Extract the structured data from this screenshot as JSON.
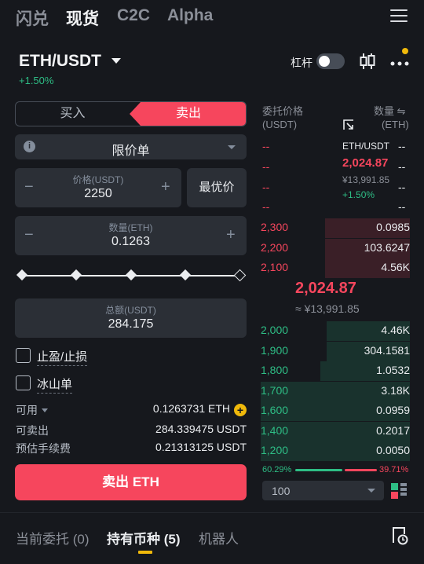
{
  "nav": {
    "tabs": [
      "闪兑",
      "现货",
      "C2C",
      "Alpha"
    ],
    "active": 1
  },
  "header": {
    "pair": "ETH/USDT",
    "change": "+1.50%",
    "leverage_label": "杠杆",
    "leverage_on": false
  },
  "order_form": {
    "buy_label": "买入",
    "sell_label": "卖出",
    "order_type": "限价单",
    "price_label": "价格(USDT)",
    "price_value": "2250",
    "best_price_label": "最优价",
    "amount_label": "数量(ETH)",
    "amount_value": "0.1263",
    "total_label": "总额(USDT)",
    "total_value": "284.175",
    "tp_sl_label": "止盈/止损",
    "iceberg_label": "冰山单",
    "available_label": "可用",
    "available_value": "0.1263731 ETH",
    "sellable_label": "可卖出",
    "sellable_value": "284.339475 USDT",
    "fee_label": "预估手续费",
    "fee_value": "0.21313125 USDT",
    "submit_label": "卖出 ETH",
    "minus": "−",
    "plus": "+"
  },
  "order_book": {
    "price_header": "委托价格",
    "price_unit": "(USDT)",
    "qty_header": "数量",
    "qty_unit": "(ETH)",
    "swap_icon": "⇋",
    "dash": "--",
    "ticker": {
      "pair": "ETH/USDT",
      "price": "2,024.87",
      "cny": "¥13,991.85",
      "change": "+1.50%"
    },
    "asks": [
      {
        "price": "2,300",
        "qty": "0.0985",
        "fill": 0.57
      },
      {
        "price": "2,200",
        "qty": "103.6247",
        "fill": 0.57
      },
      {
        "price": "2,100",
        "qty": "4.56K",
        "fill": 0.57
      }
    ],
    "mid_price": "2,024.87",
    "mid_cny": "≈ ¥13,991.85",
    "bids": [
      {
        "price": "2,000",
        "qty": "4.46K",
        "fill": 0.56
      },
      {
        "price": "1,900",
        "qty": "304.1581",
        "fill": 0.56
      },
      {
        "price": "1,800",
        "qty": "1.0532",
        "fill": 0.6
      },
      {
        "price": "1,700",
        "qty": "3.18K",
        "fill": 1.0
      },
      {
        "price": "1,600",
        "qty": "0.0959",
        "fill": 1.0
      },
      {
        "price": "1,400",
        "qty": "0.2017",
        "fill": 1.0
      },
      {
        "price": "1,200",
        "qty": "0.0050",
        "fill": 1.0
      }
    ],
    "buy_ratio": "60.29%",
    "sell_ratio": "39.71%",
    "depth": "100"
  },
  "bottom_tabs": {
    "open_orders": "当前委托",
    "open_count": "(0)",
    "holdings": "持有币种",
    "holdings_count": "(5)",
    "bots": "机器人"
  },
  "colors": {
    "sell": "#f6465d",
    "buy": "#2ebd85",
    "accent": "#f0b90b"
  },
  "icons": [
    "menu-icon",
    "caret-down-icon",
    "candlestick-icon",
    "more-icon",
    "info-icon",
    "swap-icon",
    "chart-link-icon",
    "plus-circle-icon",
    "layout-icon",
    "history-icon"
  ]
}
